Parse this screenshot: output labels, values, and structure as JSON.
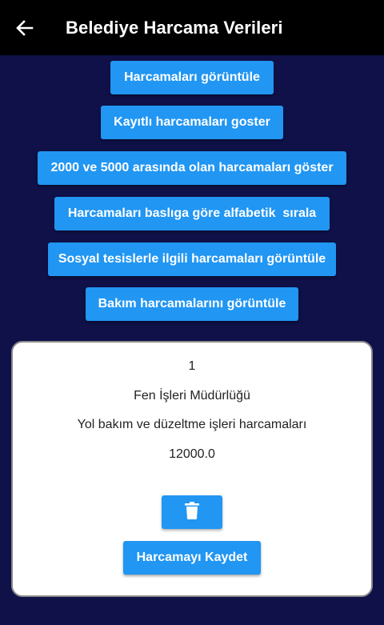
{
  "appbar": {
    "title": "Belediye Harcama Verileri",
    "back_icon": "arrow-left-icon"
  },
  "actions": [
    {
      "label": "Harcamaları görüntüle"
    },
    {
      "label": "Kayıtlı harcamaları goster"
    },
    {
      "label": "2000 ve 5000 arasında olan harcamaları göster"
    },
    {
      "label": "Harcamaları baslıga göre alfabetik  sırala"
    },
    {
      "label": "Sosyal tesislerle ilgili harcamaları görüntüle"
    },
    {
      "label": "Bakım harcamalarını görüntüle"
    }
  ],
  "record": {
    "id": "1",
    "department": "Fen İşleri Müdürlüğü",
    "description": "Yol bakım ve düzeltme işleri harcamaları",
    "amount": "12000.0",
    "delete_icon": "trash-icon",
    "save_label": "Harcamayı Kaydet"
  },
  "colors": {
    "background": "#0f1148",
    "appbar": "#000000",
    "button": "#2196f3",
    "card": "#ffffff"
  }
}
